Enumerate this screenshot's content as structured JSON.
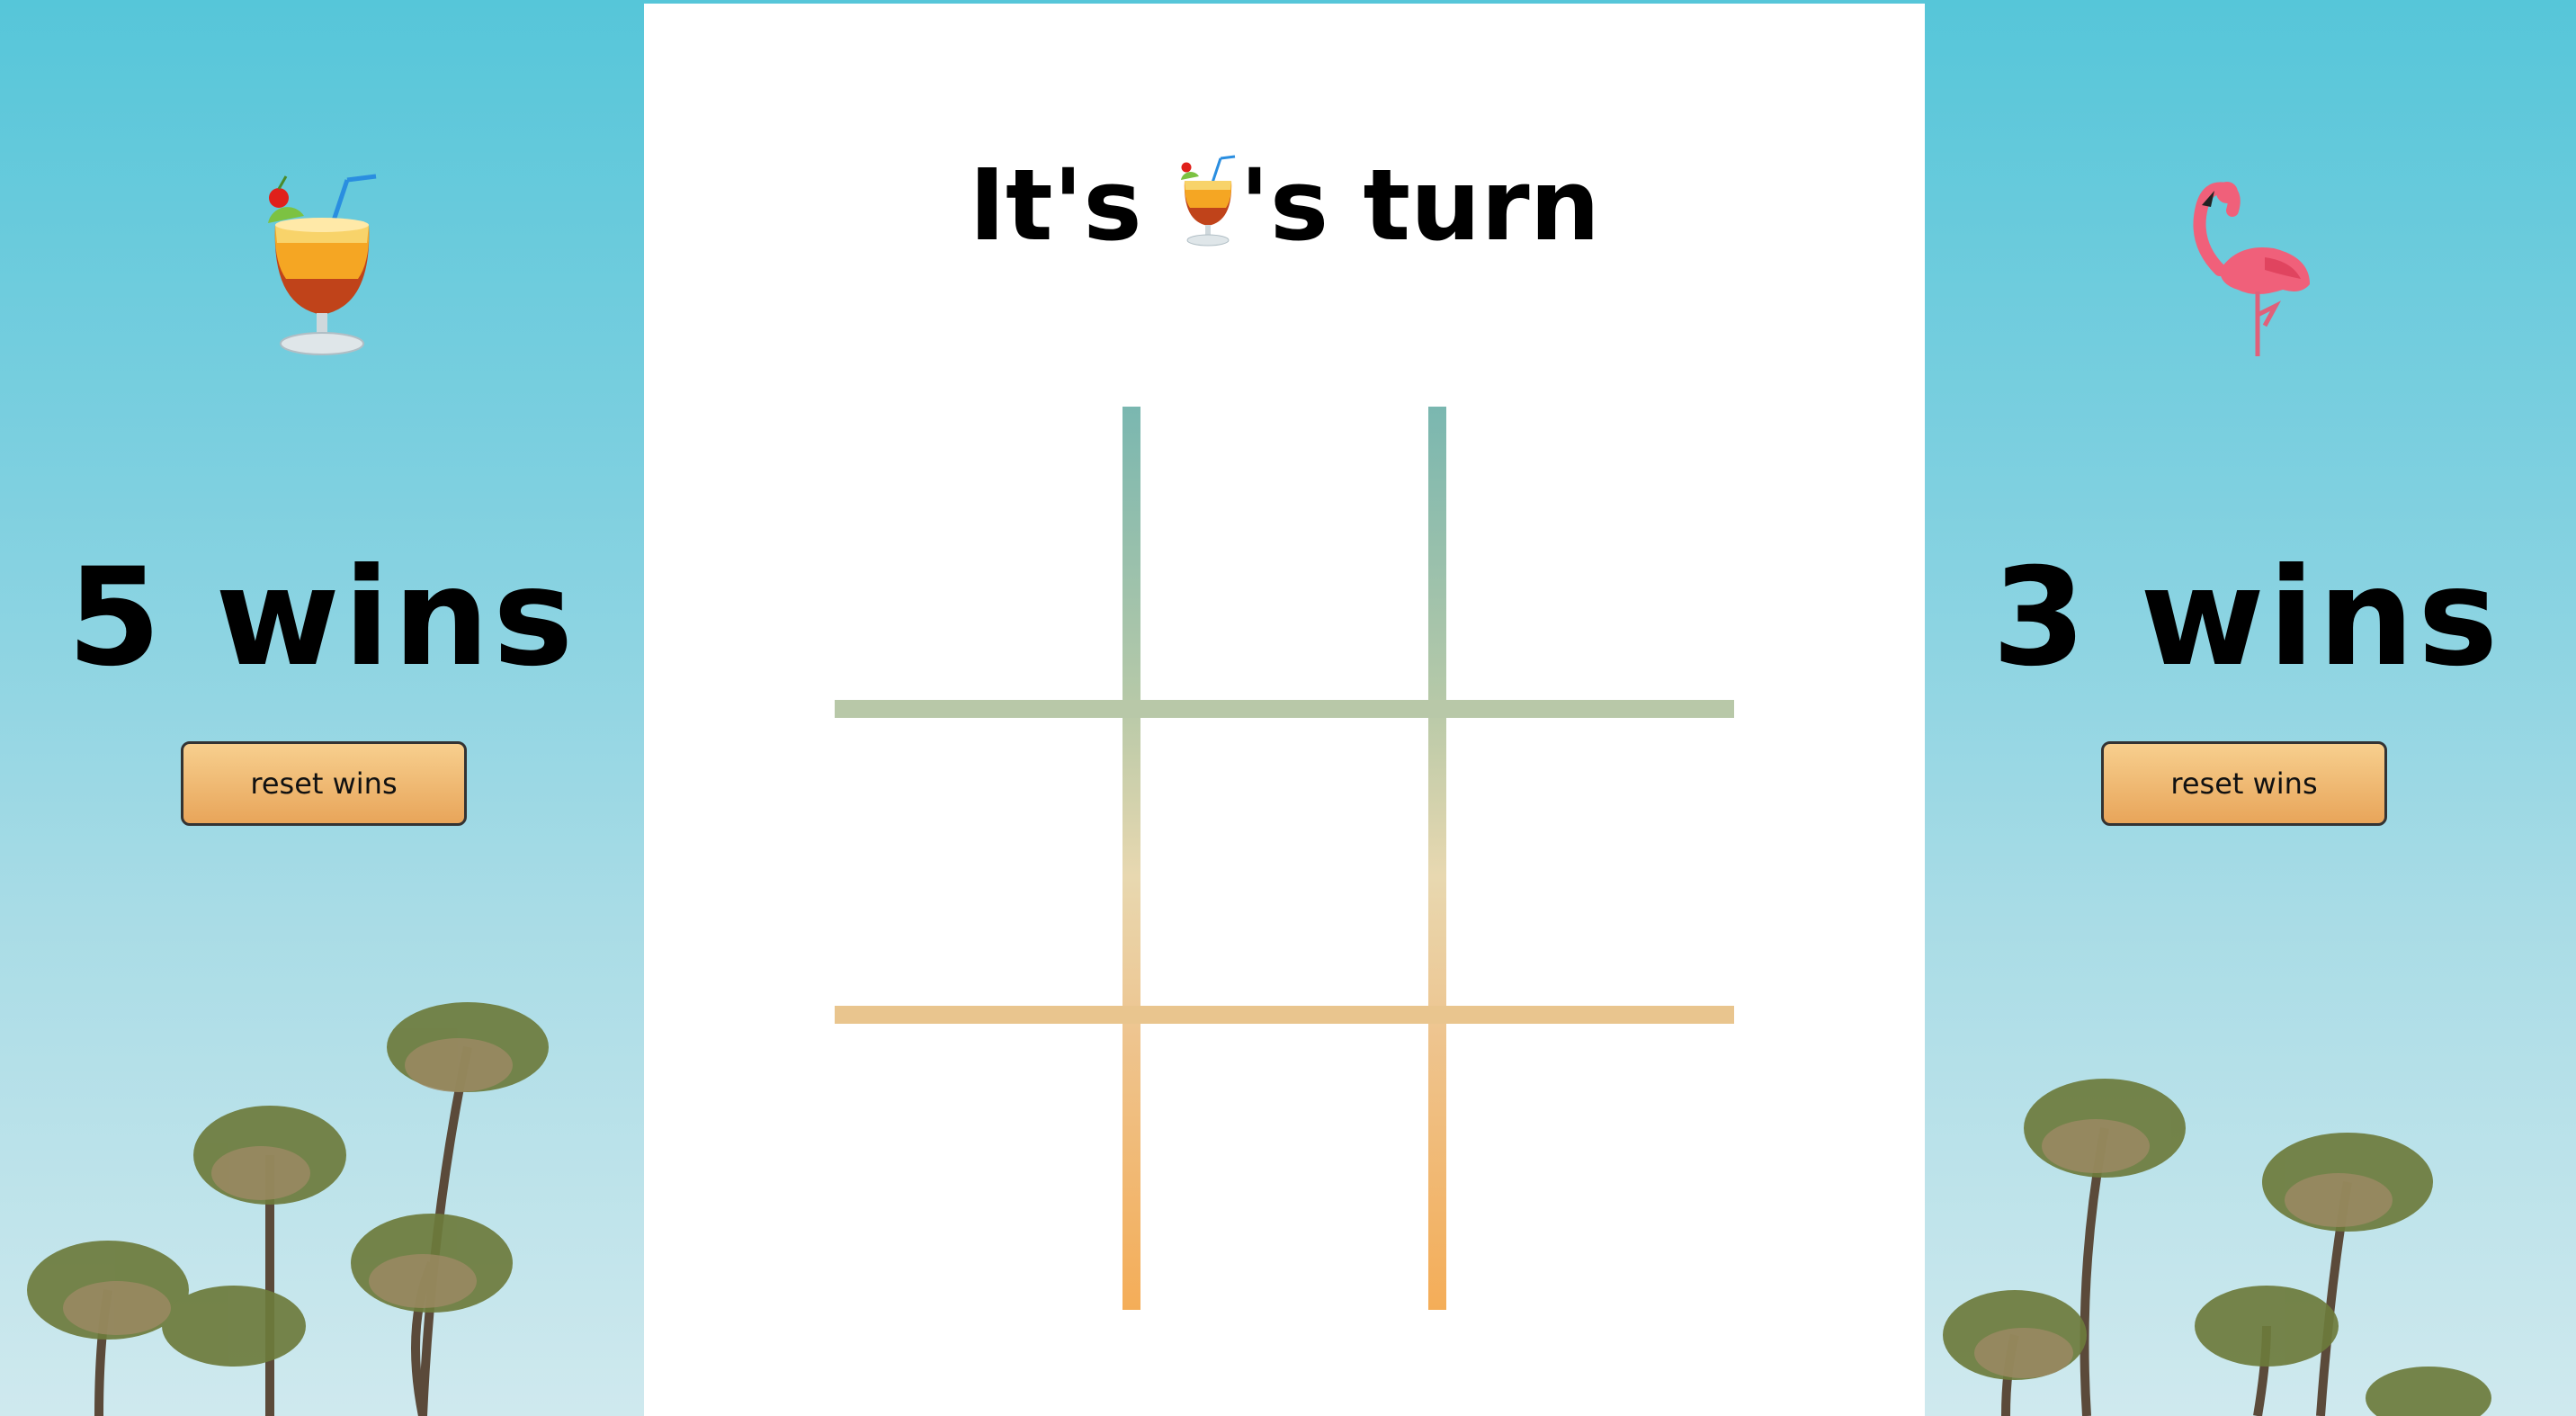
{
  "turn": {
    "prefix": "It's ",
    "player_icon": "tropical-drink-icon",
    "suffix": "'s turn"
  },
  "players": [
    {
      "icon": "tropical-drink-icon",
      "wins_text": "5 wins",
      "reset_label": "reset wins"
    },
    {
      "icon": "flamingo-icon",
      "wins_text": "3 wins",
      "reset_label": "reset wins"
    }
  ],
  "board": {
    "cells": [
      "",
      "",
      "",
      "",
      "",
      "",
      "",
      "",
      ""
    ]
  },
  "colors": {
    "sky_top": "#56c6d9",
    "sky_bottom": "#cfe9ee",
    "button": "#eeb36d",
    "grid_top": "#7ab7b0",
    "grid_bottom": "#f4ad58"
  }
}
